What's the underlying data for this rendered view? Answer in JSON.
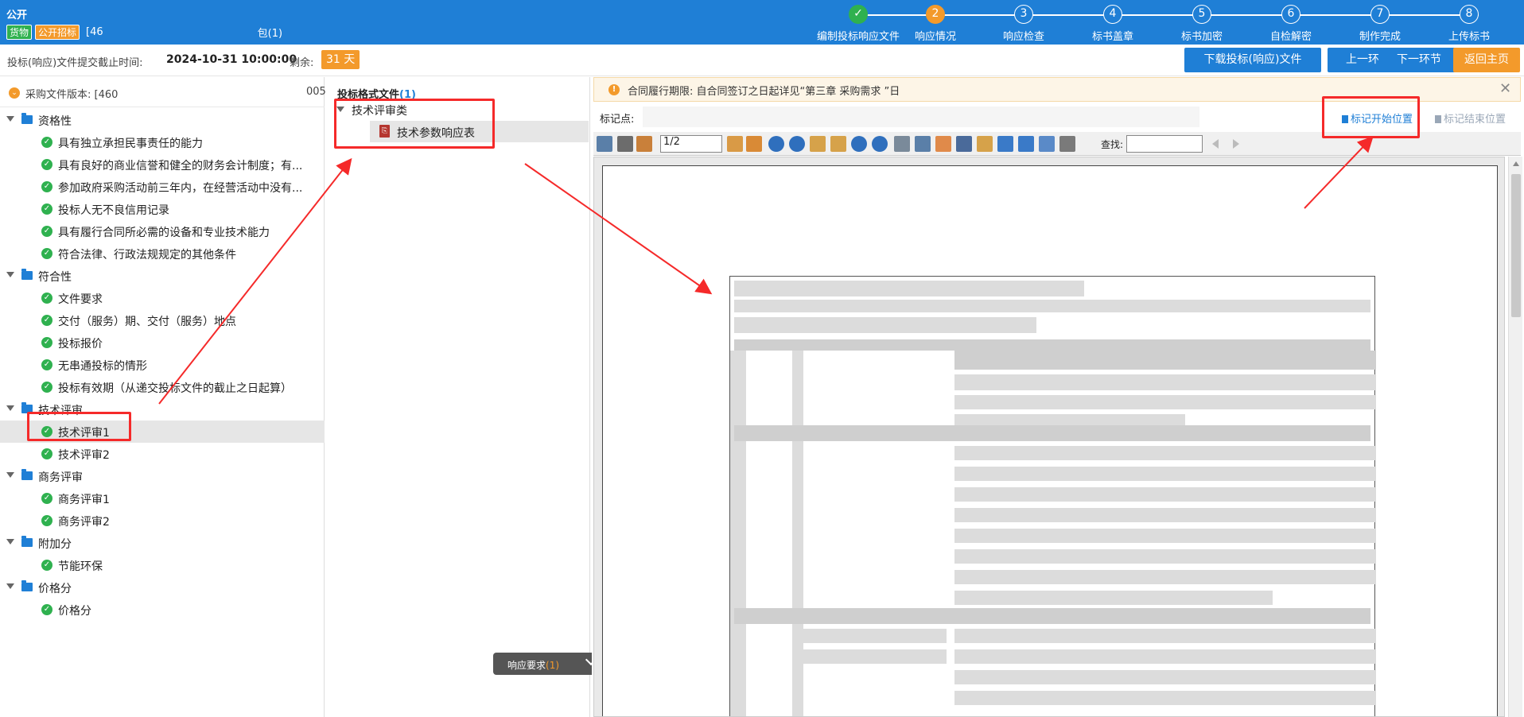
{
  "header": {
    "title": "公开",
    "tags": [
      "货物",
      "公开招标"
    ],
    "project_suffix": "[46",
    "package_text": "包(1)"
  },
  "steps": [
    {
      "num": "✓",
      "label": "编制投标响应文件",
      "state": "done"
    },
    {
      "num": "2",
      "label": "响应情况",
      "state": "active"
    },
    {
      "num": "3",
      "label": "响应检查",
      "state": "todo"
    },
    {
      "num": "4",
      "label": "标书盖章",
      "state": "todo"
    },
    {
      "num": "5",
      "label": "标书加密",
      "state": "todo"
    },
    {
      "num": "6",
      "label": "自检解密",
      "state": "todo"
    },
    {
      "num": "7",
      "label": "制作完成",
      "state": "todo"
    },
    {
      "num": "8",
      "label": "上传标书",
      "state": "todo"
    }
  ],
  "subbar": {
    "deadline_label": "投标(响应)文件提交截止时间:",
    "deadline_value": "2024-10-31 10:00:00",
    "remain_label": "剩余:",
    "remain_value": "31 天",
    "download_label": "下载投标(响应)文件",
    "prev_label": "上一环节",
    "next_label": "下一环节",
    "home_label": "返回主页"
  },
  "left": {
    "version_label": "采购文件版本: [460",
    "version_tail": "005",
    "groups": [
      {
        "label": "资格性",
        "items": [
          "具有独立承担民事责任的能力",
          "具有良好的商业信誉和健全的财务会计制度；有...",
          "参加政府采购活动前三年内，在经营活动中没有...",
          "投标人无不良信用记录",
          "具有履行合同所必需的设备和专业技术能力",
          "符合法律、行政法规规定的其他条件"
        ]
      },
      {
        "label": "符合性",
        "items": [
          "文件要求",
          "交付（服务）期、交付（服务）地点",
          "投标报价",
          "无串通投标的情形",
          "投标有效期（从递交投标文件的截止之日起算）"
        ]
      },
      {
        "label": "技术评审",
        "items": [
          "技术评审1",
          "技术评审2"
        ]
      },
      {
        "label": "商务评审",
        "items": [
          "商务评审1",
          "商务评审2"
        ]
      },
      {
        "label": "附加分",
        "items": [
          "节能环保"
        ]
      },
      {
        "label": "价格分",
        "items": [
          "价格分"
        ]
      }
    ]
  },
  "mid": {
    "title": "投标格式文件",
    "count": "(1)",
    "category": "技术评审类",
    "doc": "技术参数响应表",
    "resp_label": "响应要求",
    "resp_count": "(1)"
  },
  "right": {
    "notice": "合同履行期限: 自合同签订之日起详见“第三章 采购需求 ”日",
    "notice_close": "✕",
    "mark_label": "标记点:",
    "mark_start": "标记开始位置",
    "mark_end": "标记结束位置",
    "page_value": "1/2",
    "find_label": "查找:"
  },
  "colors": {
    "primary": "#1f7fd6",
    "accent": "#f39a2b",
    "success": "#2fb14f",
    "annotation": "#f52a2a"
  }
}
